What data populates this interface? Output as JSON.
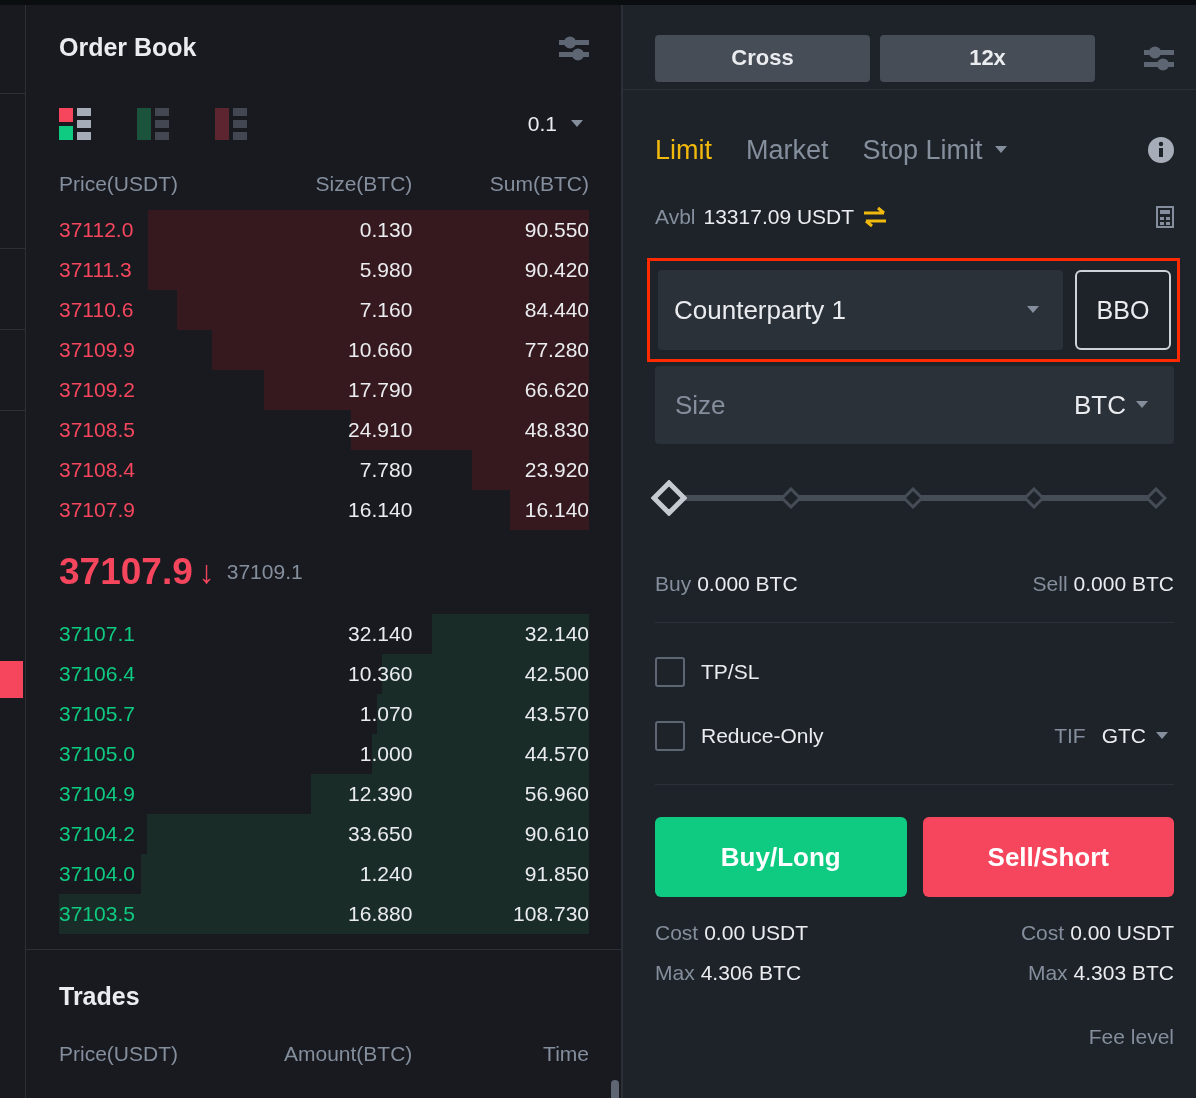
{
  "order_book": {
    "title": "Order Book",
    "precision": "0.1",
    "view_modes": [
      {
        "kind": "both",
        "selected": true
      },
      {
        "kind": "bids",
        "selected": false
      },
      {
        "kind": "asks",
        "selected": false
      }
    ],
    "columns": [
      "Price(USDT)",
      "Size(BTC)",
      "Sum(BTC)"
    ],
    "asks": [
      {
        "price": "37112.0",
        "size": "0.130",
        "sum": "90.550"
      },
      {
        "price": "37111.3",
        "size": "5.980",
        "sum": "90.420"
      },
      {
        "price": "37110.6",
        "size": "7.160",
        "sum": "84.440"
      },
      {
        "price": "37109.9",
        "size": "10.660",
        "sum": "77.280"
      },
      {
        "price": "37109.2",
        "size": "17.790",
        "sum": "66.620"
      },
      {
        "price": "37108.5",
        "size": "24.910",
        "sum": "48.830"
      },
      {
        "price": "37108.4",
        "size": "7.780",
        "sum": "23.920"
      },
      {
        "price": "37107.9",
        "size": "16.140",
        "sum": "16.140"
      }
    ],
    "last_price": "37107.9",
    "arrow": "↓",
    "mark_price": "37109.1",
    "bids": [
      {
        "price": "37107.1",
        "size": "32.140",
        "sum": "32.140"
      },
      {
        "price": "37106.4",
        "size": "10.360",
        "sum": "42.500"
      },
      {
        "price": "37105.7",
        "size": "1.070",
        "sum": "43.570"
      },
      {
        "price": "37105.0",
        "size": "1.000",
        "sum": "44.570"
      },
      {
        "price": "37104.9",
        "size": "12.390",
        "sum": "56.960"
      },
      {
        "price": "37104.2",
        "size": "33.650",
        "sum": "90.610"
      },
      {
        "price": "37104.0",
        "size": "1.240",
        "sum": "91.850"
      },
      {
        "price": "37103.5",
        "size": "16.880",
        "sum": "108.730"
      }
    ]
  },
  "trades": {
    "title": "Trades",
    "columns": [
      "Price(USDT)",
      "Amount(BTC)",
      "Time"
    ]
  },
  "order_form": {
    "margin_mode": "Cross",
    "leverage": "12x",
    "order_types": [
      {
        "label": "Limit",
        "selected": true
      },
      {
        "label": "Market",
        "selected": false
      },
      {
        "label": "Stop Limit",
        "selected": false
      }
    ],
    "available_label": "Avbl",
    "available": "13317.09 USDT",
    "price_source": "Counterparty 1",
    "bbo": "BBO",
    "highlighted": true,
    "size_placeholder": "Size",
    "size_unit": "BTC",
    "slider": {
      "level": 0
    },
    "buy_label": "Buy",
    "buy_amount": "0.000 BTC",
    "sell_label": "Sell",
    "sell_amount": "0.000 BTC",
    "options": [
      {
        "label": "TP/SL",
        "checked": false
      },
      {
        "label": "Reduce-Only",
        "checked": false
      }
    ],
    "tif_label": "TIF",
    "tif": "GTC",
    "buy_button": "Buy/Long",
    "sell_button": "Sell/Short",
    "costs": [
      {
        "cost_label": "Cost",
        "cost": "0.00 USDT",
        "max_label": "Max",
        "max": "4.306 BTC"
      },
      {
        "cost_label": "Cost",
        "cost": "0.00 USDT",
        "max_label": "Max",
        "max": "4.303 BTC"
      }
    ],
    "fee_level": "Fee level"
  }
}
